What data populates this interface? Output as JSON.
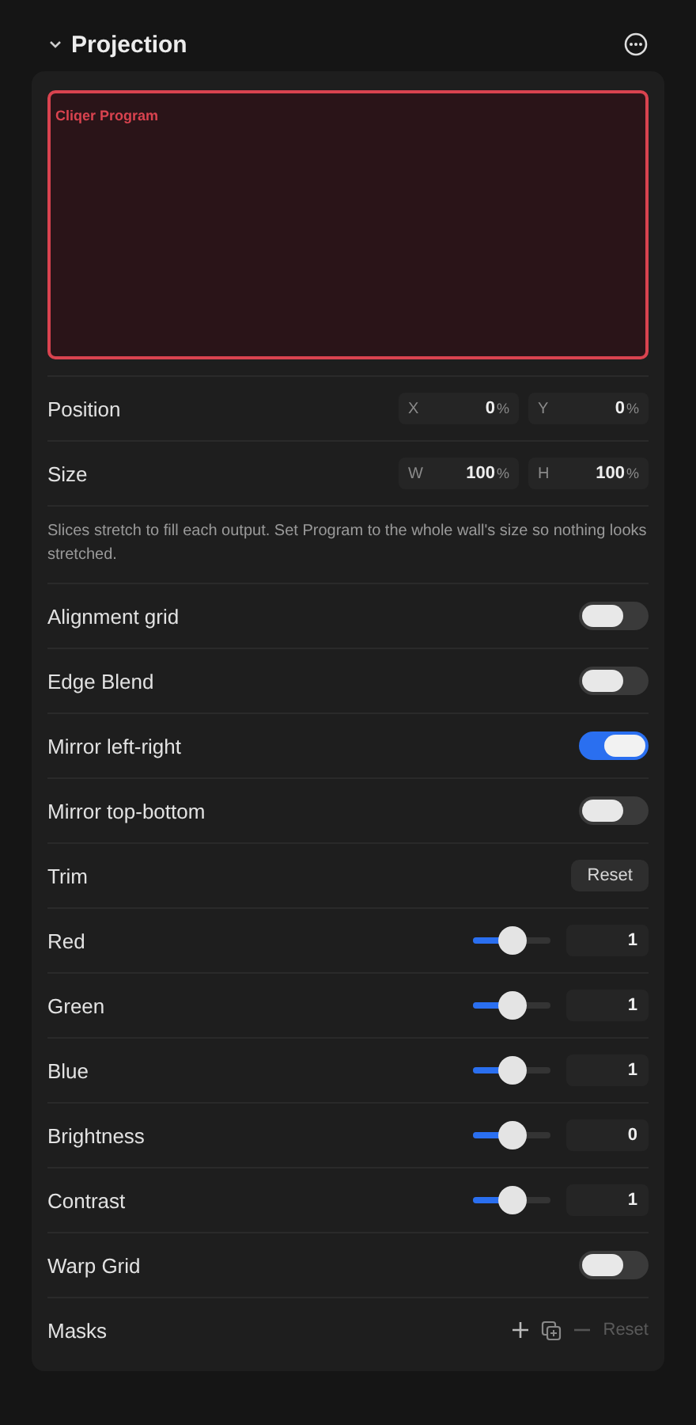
{
  "header": {
    "title": "Projection",
    "expanded": true
  },
  "preview": {
    "label": "Cliqer Program"
  },
  "rows": [
    {
      "kind": "pair",
      "label": "Position",
      "fields": [
        {
          "axis": "X",
          "value": "0",
          "unit": "%"
        },
        {
          "axis": "Y",
          "value": "0",
          "unit": "%"
        }
      ]
    },
    {
      "kind": "pair",
      "label": "Size",
      "fields": [
        {
          "axis": "W",
          "value": "100",
          "unit": "%"
        },
        {
          "axis": "H",
          "value": "100",
          "unit": "%"
        }
      ]
    },
    {
      "kind": "note",
      "text": "Slices stretch to fill each output. Set Program to the whole wall's size so nothing looks stretched."
    },
    {
      "kind": "toggle",
      "label": "Alignment grid",
      "on": false
    },
    {
      "kind": "toggle",
      "label": "Edge Blend",
      "on": false
    },
    {
      "kind": "toggle",
      "label": "Mirror left-right",
      "on": true
    },
    {
      "kind": "toggle",
      "label": "Mirror top-bottom",
      "on": false
    },
    {
      "kind": "button",
      "label": "Trim",
      "button": "Reset"
    },
    {
      "kind": "slider",
      "label": "Red",
      "level": 0.5,
      "value": "1"
    },
    {
      "kind": "slider",
      "label": "Green",
      "level": 0.5,
      "value": "1"
    },
    {
      "kind": "slider",
      "label": "Blue",
      "level": 0.5,
      "value": "1"
    },
    {
      "kind": "slider",
      "label": "Brightness",
      "level": 0.5,
      "value": "0"
    },
    {
      "kind": "slider",
      "label": "Contrast",
      "level": 0.5,
      "value": "1"
    },
    {
      "kind": "toggle",
      "label": "Warp Grid",
      "on": false
    },
    {
      "kind": "masks",
      "label": "Masks",
      "reset": "Reset",
      "remove_disabled": true,
      "reset_disabled": true
    }
  ]
}
